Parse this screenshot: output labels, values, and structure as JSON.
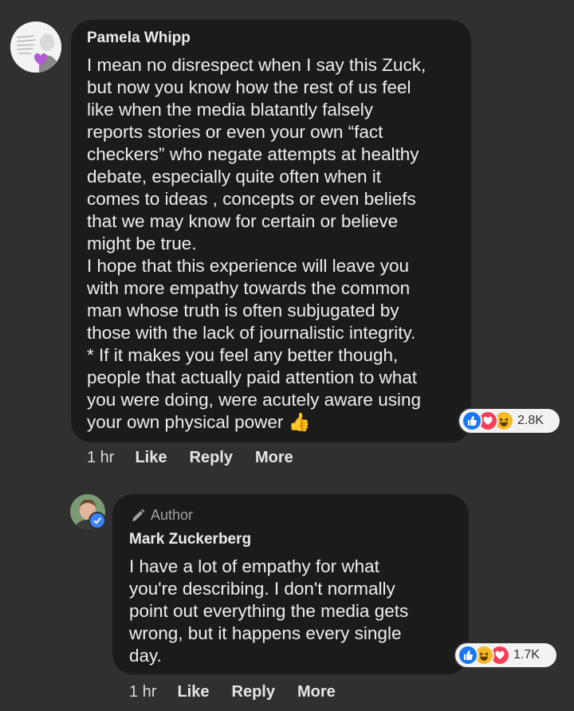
{
  "comment1": {
    "author": "Pamela Whipp",
    "text": "I mean no disrespect when I say this Zuck,\nbut now you know how the rest of us feel\nlike when the media blatantly falsely\nreports stories or even your own “fact\ncheckers” who negate attempts at healthy\ndebate, especially quite often when it\ncomes to ideas , concepts or even beliefs\nthat we may know for certain or believe\nmight be true.\nI hope that this experience will leave you\nwith more empathy towards the common\nman whose truth is often subjugated by\nthose with the lack of journalistic integrity.\n* If it makes you feel any better though,\npeople that actually paid attention to what\nyou were doing, were acutely aware using\nyour own physical power",
    "emoji": "👍",
    "reactions": [
      "like",
      "love",
      "haha"
    ],
    "reaction_count": "2.8K",
    "time": "1 hr",
    "like_label": "Like",
    "reply_label": "Reply",
    "more_label": "More"
  },
  "comment2": {
    "badge": "Author",
    "author": "Mark Zuckerberg",
    "text": "I have a lot of empathy for what\nyou're describing. I don't normally\npoint out everything the media gets\nwrong, but it happens every single\nday.",
    "reactions": [
      "like",
      "haha",
      "love"
    ],
    "reaction_count": "1.7K",
    "time": "1 hr",
    "like_label": "Like",
    "reply_label": "Reply",
    "more_label": "More"
  },
  "colors": {
    "background": "#303030",
    "bubble": "#1b1b1b",
    "like_blue": "#1877f2",
    "love_red": "#f33e58",
    "haha_yellow": "#f7b928"
  }
}
